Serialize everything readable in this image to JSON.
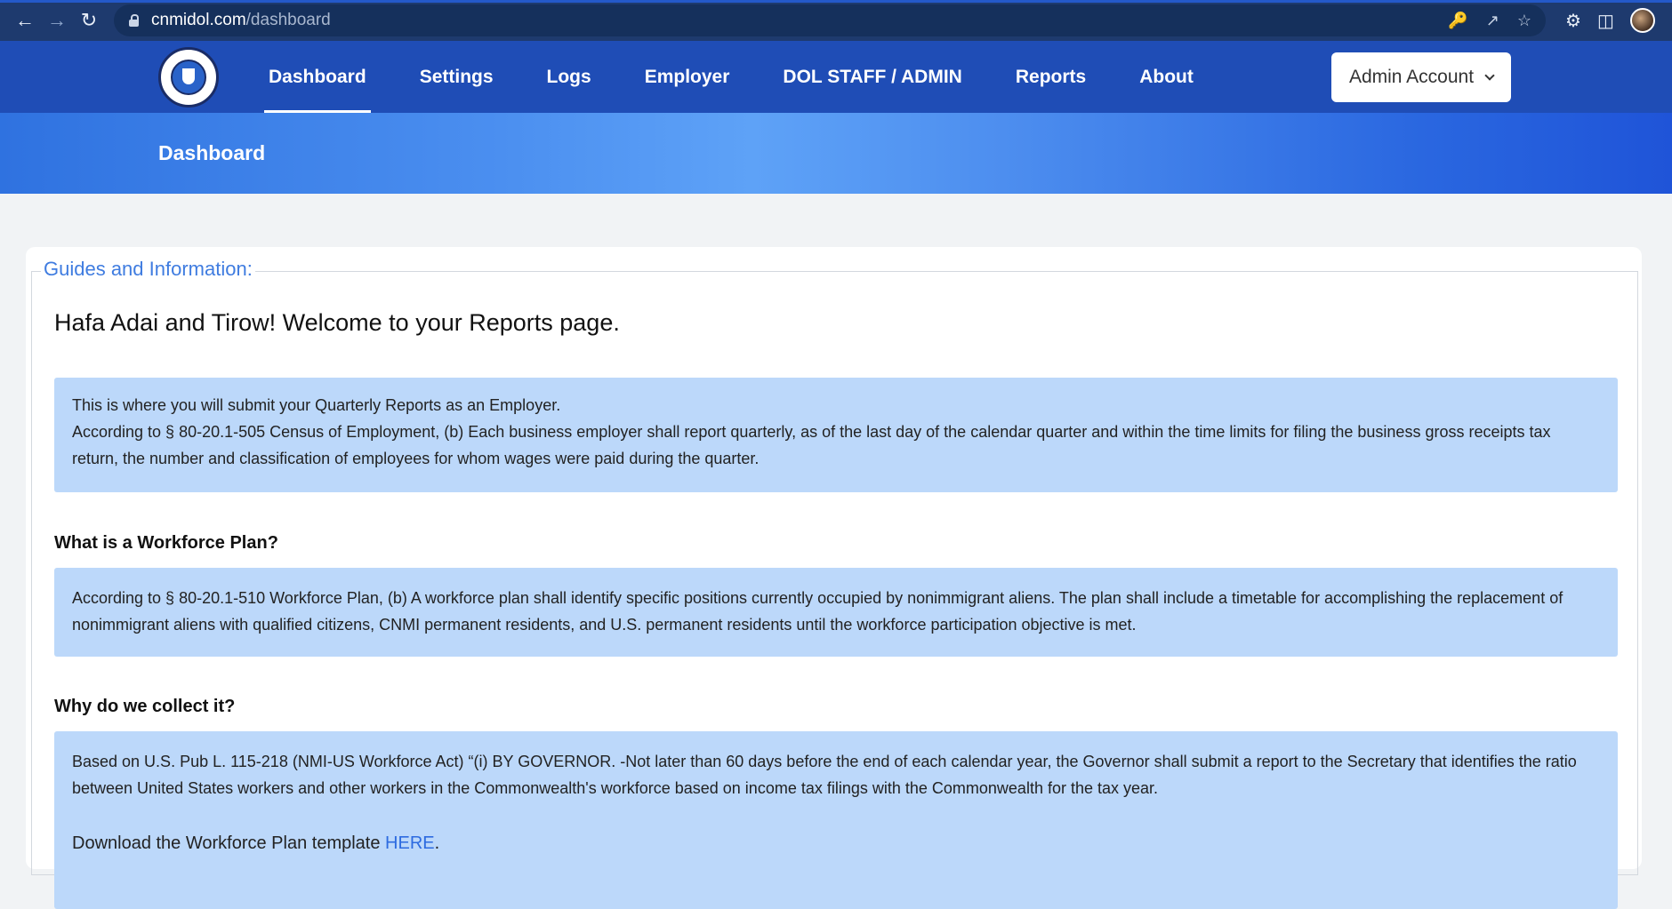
{
  "browser": {
    "url_host": "cnmidol.com",
    "url_path": "/dashboard"
  },
  "navbar": {
    "items": [
      {
        "label": "Dashboard"
      },
      {
        "label": "Settings"
      },
      {
        "label": "Logs"
      },
      {
        "label": "Employer"
      },
      {
        "label": "DOL STAFF / ADMIN"
      },
      {
        "label": "Reports"
      },
      {
        "label": "About"
      }
    ],
    "account_label": "Admin Account"
  },
  "banner": {
    "title": "Dashboard"
  },
  "guides": {
    "legend": "Guides and Information:",
    "welcome": "Hafa Adai and Tirow! Welcome to your Reports page.",
    "intro_line1": "This is where you will submit your Quarterly Reports as an Employer.",
    "intro_line2": "According to § 80-20.1-505 Census of Employment, (b) Each business employer shall report quarterly, as of the last day of the calendar quarter and within the time limits for filing the business gross receipts tax return, the number and classification of employees for whom wages were paid during the quarter.",
    "q1": "What is a Workforce Plan?",
    "a1": "According to § 80-20.1-510 Workforce Plan, (b) A workforce plan shall identify specific positions currently occupied by nonimmigrant aliens. The plan shall include a timetable for accomplishing the replacement of nonimmigrant aliens with qualified citizens, CNMI permanent residents, and U.S. permanent residents until the workforce participation objective is met.",
    "q2": "Why do we collect it?",
    "a2": "Based on U.S. Pub L. 115-218 (NMI-US Workforce Act) “(i) BY GOVERNOR. -Not later than 60 days before the end of each calendar year, the Governor shall submit a report to the Secretary that identifies the ratio between United States workers and other workers in the Commonwealth's workforce based on income tax filings with the Commonwealth for the tax year.",
    "download_prefix": "Download the Workforce Plan template ",
    "download_link": "HERE",
    "download_suffix": "."
  }
}
